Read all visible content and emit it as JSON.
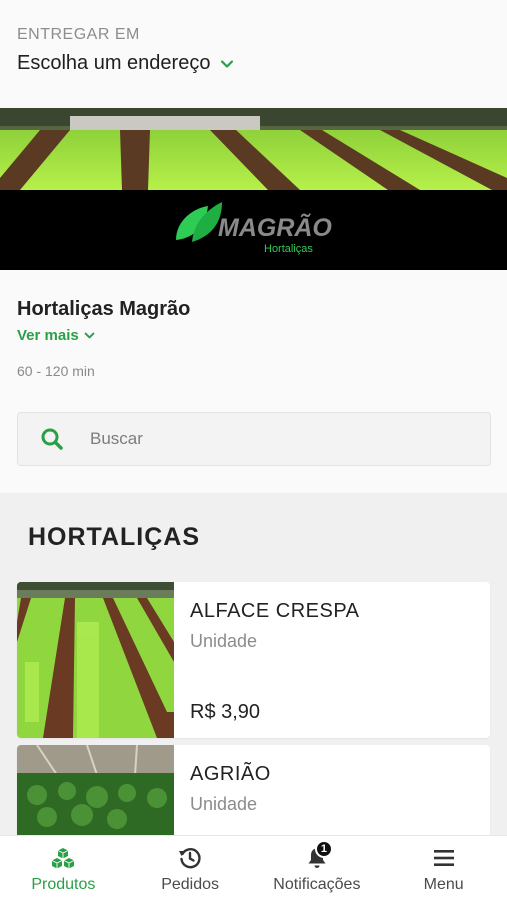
{
  "address": {
    "label": "ENTREGAR EM",
    "choose": "Escolha um endereço"
  },
  "banner": {
    "brand_name": "MAGRÃO",
    "brand_sub": "Hortaliças"
  },
  "store": {
    "name": "Hortaliças Magrão",
    "more": "Ver mais",
    "delivery_time": "60 - 120 min"
  },
  "search": {
    "placeholder": "Buscar"
  },
  "catalog": {
    "section_title": "HORTALIÇAS",
    "products": [
      {
        "name": "ALFACE CRESPA",
        "unit": "Unidade",
        "price": "R$ 3,90"
      },
      {
        "name": "AGRIÃO",
        "unit": "Unidade",
        "price": ""
      }
    ]
  },
  "tabbar": {
    "tabs": [
      {
        "label": "Produtos",
        "icon": "boxes-icon",
        "active": true
      },
      {
        "label": "Pedidos",
        "icon": "history-icon",
        "active": false
      },
      {
        "label": "Notificações",
        "icon": "bell-icon",
        "active": false,
        "badge": "1"
      },
      {
        "label": "Menu",
        "icon": "hamburger-menu-icon",
        "active": false
      }
    ]
  },
  "colors": {
    "accent": "#2b9f48",
    "background": "#fafafa",
    "catalog_bg": "#f0f0f0"
  }
}
